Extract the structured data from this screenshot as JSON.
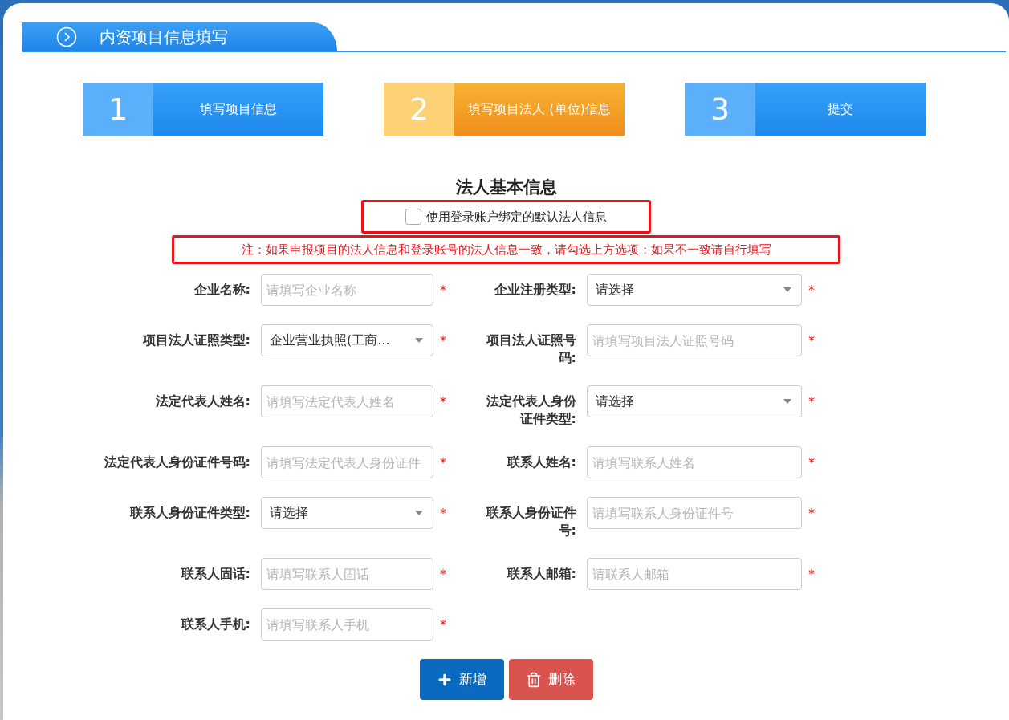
{
  "header": {
    "title": "内资项目信息填写"
  },
  "steps": [
    {
      "number": "1",
      "label": "填写项目信息",
      "selected": false
    },
    {
      "number": "2",
      "label": "填写项目法人 (单位)信息",
      "selected": true
    },
    {
      "number": "3",
      "label": "提交",
      "selected": false
    }
  ],
  "section_title": "法人基本信息",
  "default_option": {
    "label": "使用登录账户绑定的默认法人信息",
    "checked": false
  },
  "note": "注：如果申报项目的法人信息和登录账号的法人信息一致，请勾选上方选项；如果不一致请自行填写",
  "fields": [
    {
      "label": "企业名称:",
      "kind": "input",
      "placeholder": "请填写企业名称",
      "required_mark": "*"
    },
    {
      "label": "企业注册类型:",
      "kind": "select",
      "value": "请选择",
      "required_mark": "*"
    },
    {
      "label": "项目法人证照类型:",
      "kind": "select",
      "value": "企业营业执照(工商...",
      "required_mark": "*"
    },
    {
      "label": "项目法人证照号码:",
      "kind": "input",
      "placeholder": "请填写项目法人证照号码",
      "required_mark": "*"
    },
    {
      "label": "法定代表人姓名:",
      "kind": "input",
      "placeholder": "请填写法定代表人姓名",
      "required_mark": "*"
    },
    {
      "label": "法定代表人身份证件类型:",
      "kind": "select",
      "value": "请选择",
      "required_mark": "*"
    },
    {
      "label": "法定代表人身份证件号码:",
      "kind": "input",
      "placeholder": "请填写法定代表人身份证件",
      "required_mark": "*"
    },
    {
      "label": "联系人姓名:",
      "kind": "input",
      "placeholder": "请填写联系人姓名",
      "required_mark": "*"
    },
    {
      "label": "联系人身份证件类型:",
      "kind": "select",
      "value": "请选择",
      "required_mark": "*"
    },
    {
      "label": "联系人身份证件号:",
      "kind": "input",
      "placeholder": "请填写联系人身份证件号",
      "required_mark": "*"
    },
    {
      "label": "联系人固话:",
      "kind": "input",
      "placeholder": "请填写联系人固话",
      "required_mark": "*"
    },
    {
      "label": "联系人邮箱:",
      "kind": "input",
      "placeholder": "请联系人邮箱",
      "required_mark": "*"
    },
    {
      "label": "联系人手机:",
      "kind": "input",
      "placeholder": "请填写联系人手机",
      "required_mark": "*"
    }
  ],
  "buttons": [
    {
      "label": "新增",
      "kind": "add"
    },
    {
      "label": "删除",
      "kind": "delete"
    }
  ]
}
